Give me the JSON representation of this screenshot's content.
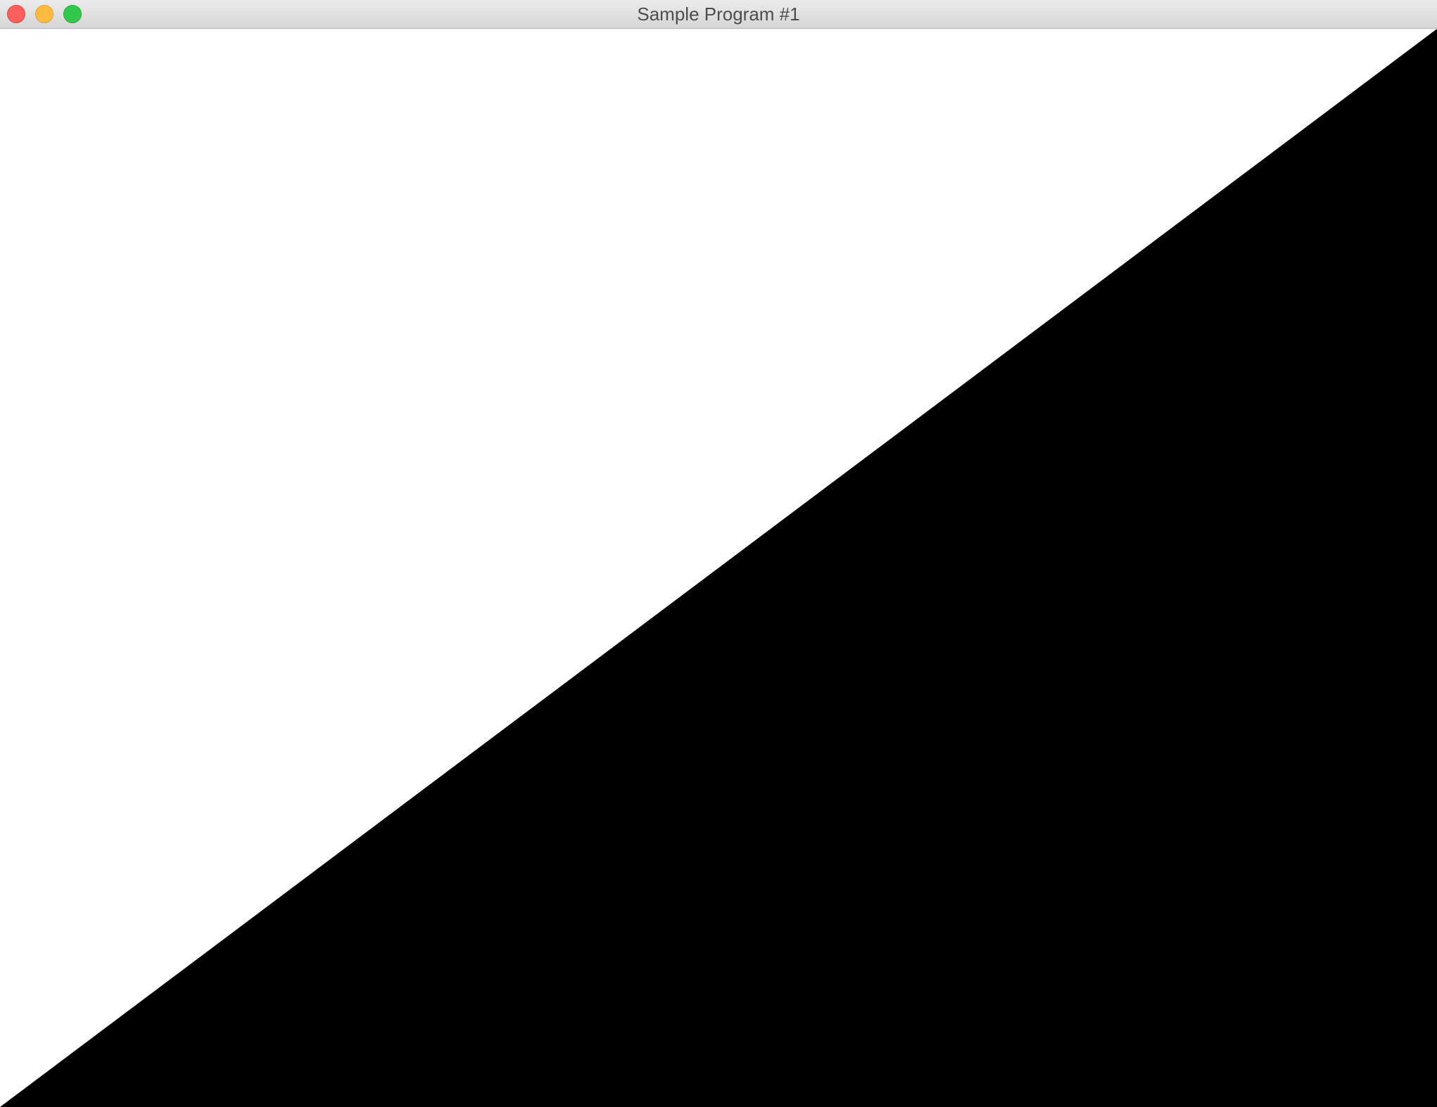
{
  "window": {
    "title": "Sample Program #1",
    "controls": {
      "close_color": "#fc605c",
      "minimize_color": "#fdbc40",
      "maximize_color": "#34c84a"
    }
  },
  "canvas": {
    "background_color": "#ffffff",
    "shape": "triangle",
    "shape_fill_color": "#000000"
  }
}
